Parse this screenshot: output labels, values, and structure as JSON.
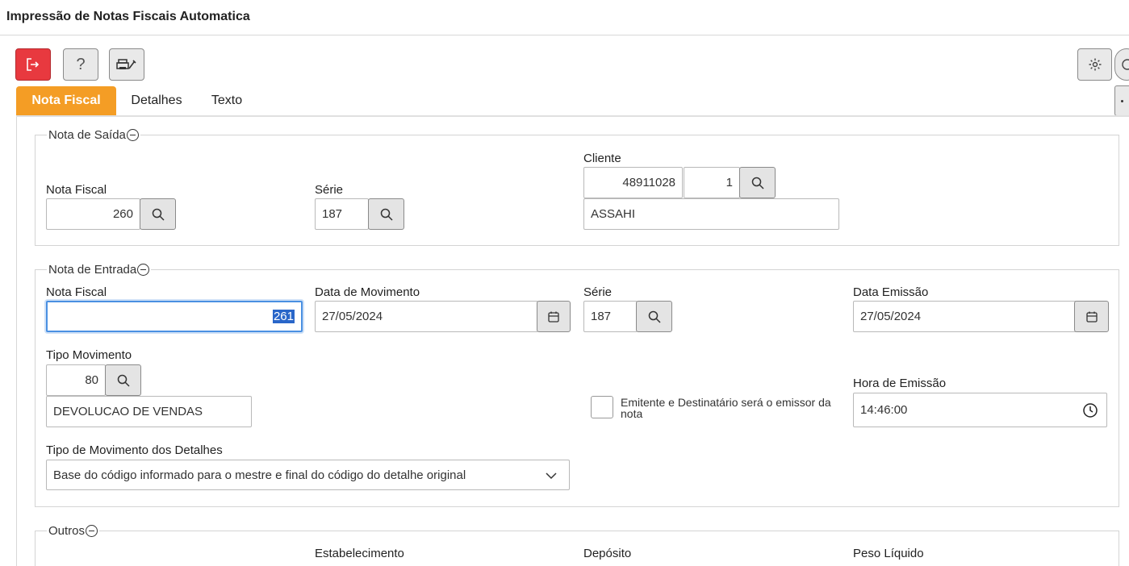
{
  "window": {
    "title": "Impressão de Notas Fiscais Automatica"
  },
  "toolbar": {
    "exit_icon": "exit-icon",
    "help_label": "?",
    "print_icon": "printer-config-icon",
    "settings_icon": "gear-icon"
  },
  "tabs": [
    {
      "label": "Nota Fiscal",
      "active": true
    },
    {
      "label": "Detalhes",
      "active": false
    },
    {
      "label": "Texto",
      "active": false
    }
  ],
  "nota_saida": {
    "legend": "Nota de Saída",
    "nota_fiscal": {
      "label": "Nota Fiscal",
      "value": "260"
    },
    "serie": {
      "label": "Série",
      "value": "187"
    },
    "cliente": {
      "label": "Cliente",
      "codigo": "48911028",
      "loja": "1",
      "nome": "ASSAHI"
    }
  },
  "nota_entrada": {
    "legend": "Nota de Entrada",
    "nota_fiscal": {
      "label": "Nota Fiscal",
      "value": "261"
    },
    "data_movimento": {
      "label": "Data de Movimento",
      "value": "27/05/2024"
    },
    "serie": {
      "label": "Série",
      "value": "187"
    },
    "data_emissao": {
      "label": "Data Emissão",
      "value": "27/05/2024"
    },
    "tipo_movimento": {
      "label": "Tipo Movimento",
      "codigo": "80",
      "descricao": "DEVOLUCAO DE VENDAS"
    },
    "emitente_checkbox": {
      "label": "Emitente e Destinatário será o emissor da nota",
      "checked": false
    },
    "hora_emissao": {
      "label": "Hora de Emissão",
      "value": "14:46:00"
    },
    "tipo_mov_detalhes": {
      "label": "Tipo de Movimento dos Detalhes",
      "value": "Base do código informado para o mestre e final do código do detalhe original"
    }
  },
  "outros": {
    "legend": "Outros",
    "estabelecimento_label": "Estabelecimento",
    "deposito_label": "Depósito",
    "peso_liquido_label": "Peso Líquido"
  },
  "colors": {
    "accent": "#f49d25",
    "exit": "#e8393f",
    "focus": "#4a90e2"
  }
}
